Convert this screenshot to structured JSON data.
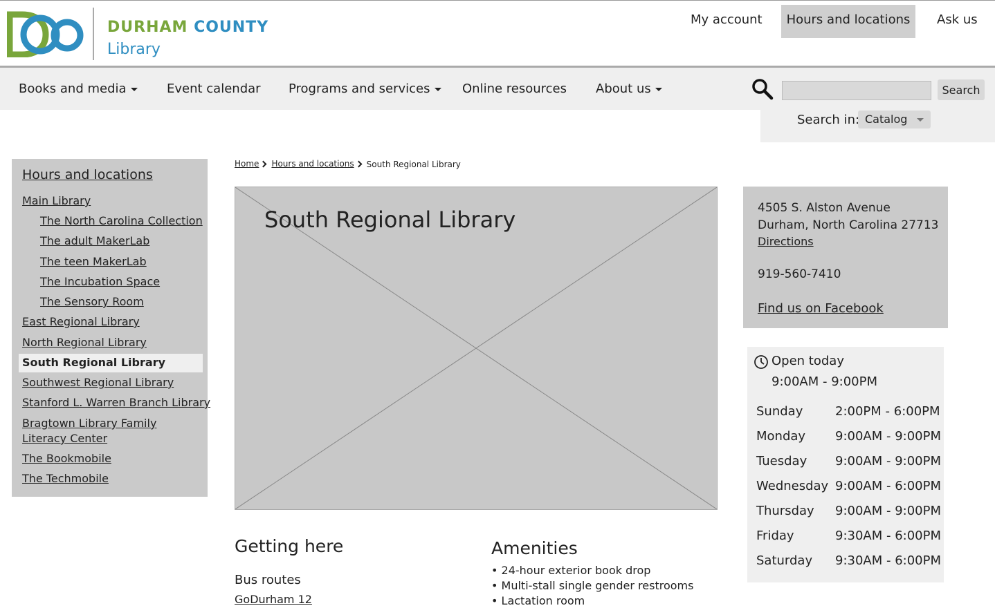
{
  "header": {
    "logo_county": "DURHAM COUNTY",
    "logo_library": "Library",
    "utility_nav": [
      "My account",
      "Hours and locations",
      "Ask us"
    ]
  },
  "main_nav": {
    "items": [
      {
        "label": "Books and media",
        "dropdown": true
      },
      {
        "label": "Event calendar",
        "dropdown": false
      },
      {
        "label": "Programs and services",
        "dropdown": true
      },
      {
        "label": "Online resources",
        "dropdown": false
      },
      {
        "label": "About us",
        "dropdown": true
      }
    ]
  },
  "search": {
    "input_value": "",
    "button_label": "Search",
    "search_in_label": "Search in:",
    "scope_value": "Catalog",
    "icon": "magnifier-icon"
  },
  "sidebar": {
    "title": "Hours and locations",
    "items": [
      {
        "label": "Main Library",
        "level": 0
      },
      {
        "label": "The North Carolina Collection",
        "level": 1
      },
      {
        "label": "The adult MakerLab",
        "level": 1
      },
      {
        "label": "The teen MakerLab",
        "level": 1
      },
      {
        "label": "The Incubation Space",
        "level": 1
      },
      {
        "label": "The Sensory Room",
        "level": 1
      },
      {
        "label": "East Regional Library",
        "level": 0
      },
      {
        "label": "North Regional Library",
        "level": 0
      },
      {
        "label": "South Regional Library",
        "level": 0,
        "active": true
      },
      {
        "label": "Southwest Regional Library",
        "level": 0
      },
      {
        "label": "Stanford L. Warren Branch Library",
        "level": 0
      },
      {
        "label": "Bragtown Library Family",
        "label_line2": "Literacy Center",
        "level": 0
      },
      {
        "label": "The Bookmobile",
        "level": 0
      },
      {
        "label": "The Techmobile",
        "level": 0
      }
    ]
  },
  "breadcrumb": [
    "Home",
    "Hours and locations",
    "South Regional Library"
  ],
  "hero": {
    "title": "South Regional Library"
  },
  "address": {
    "line1": "4505 S. Alston Avenue",
    "line2": "Durham, North Carolina 27713",
    "directions": "Directions",
    "phone": "919-560-7410",
    "facebook": "Find us on Facebook"
  },
  "hours": {
    "open_today_label": "Open today",
    "open_today_hours": "9:00AM - 9:00PM",
    "week": [
      {
        "day": "Sunday",
        "time": "2:00PM - 6:00PM"
      },
      {
        "day": "Monday",
        "time": "9:00AM - 9:00PM"
      },
      {
        "day": "Tuesday",
        "time": "9:00AM - 9:00PM"
      },
      {
        "day": "Wednesday",
        "time": "9:00AM - 6:00PM"
      },
      {
        "day": "Thursday",
        "time": "9:00AM - 9:00PM"
      },
      {
        "day": "Friday",
        "time": "9:30AM - 6:00PM"
      },
      {
        "day": "Saturday",
        "time": "9:30AM - 6:00PM"
      }
    ]
  },
  "getting_here": {
    "title": "Getting here",
    "bus_label": "Bus routes",
    "bus_route": "GoDurham 12"
  },
  "amenities": {
    "title": "Amenities",
    "items": [
      "• 24-hour exterior book drop",
      "• Multi-stall single gender restrooms",
      "• Lactation room"
    ]
  },
  "colors": {
    "logo_green": "#79a63b",
    "logo_blue": "#2f8ec1",
    "panel_gray": "#cacaca",
    "light_gray": "#efefef"
  }
}
